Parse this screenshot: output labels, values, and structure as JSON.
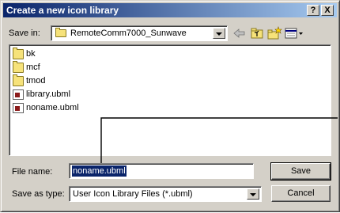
{
  "dialog": {
    "title": "Create a new icon library",
    "help_button": "?",
    "close_button": "X"
  },
  "save_in": {
    "label": "Save in:",
    "value": "RemoteComm7000_Sunwave",
    "icon": "folder-icon"
  },
  "toolbar": {
    "icons": [
      "back-arrow-icon",
      "up-one-level-icon",
      "new-folder-icon",
      "view-menu-icon"
    ]
  },
  "files": [
    {
      "name": "bk",
      "type": "folder"
    },
    {
      "name": "mcf",
      "type": "folder"
    },
    {
      "name": "tmod",
      "type": "folder"
    },
    {
      "name": "library.ubml",
      "type": "file"
    },
    {
      "name": "noname.ubml",
      "type": "file"
    }
  ],
  "file_name": {
    "label": "File name:",
    "value": "noname.ubml"
  },
  "save_as_type": {
    "label": "Save as type:",
    "value": "User Icon Library Files (*.ubml)"
  },
  "buttons": {
    "save": "Save",
    "cancel": "Cancel"
  },
  "colors": {
    "title_start": "#0a246a",
    "title_end": "#a6caf0",
    "dialog_bg": "#d4d0c8",
    "selection": "#0a246a"
  }
}
